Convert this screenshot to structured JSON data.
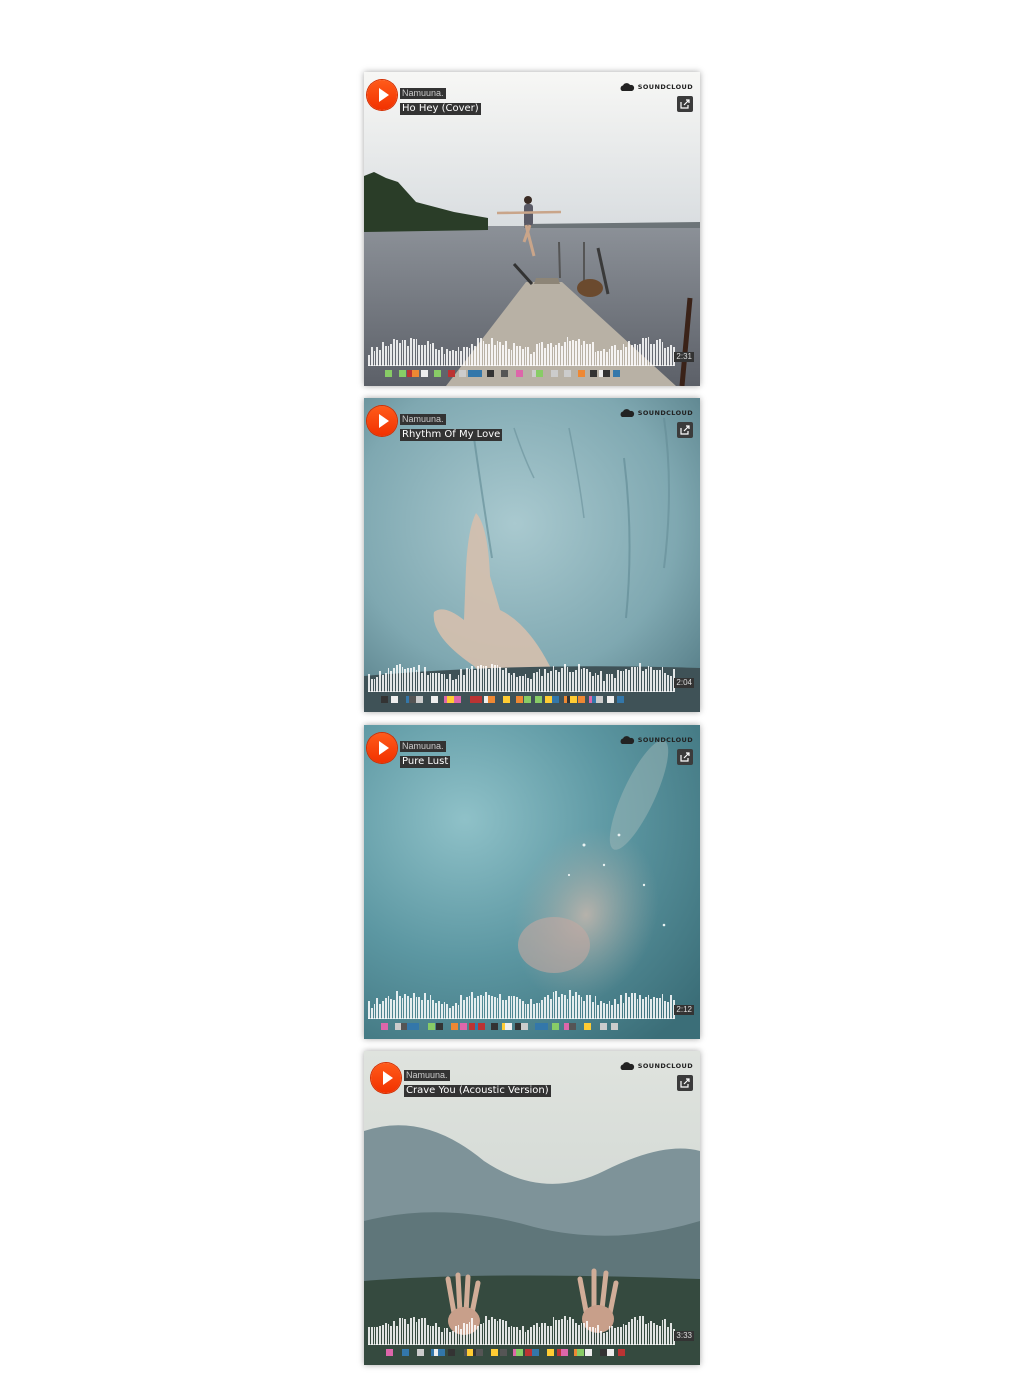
{
  "brand": {
    "accent": "#ff5500",
    "logo_text": "SOUNDCLOUD"
  },
  "players": [
    {
      "artist": "Namuuna.",
      "title": "Ho Hey (Cover)",
      "duration": "2:31",
      "artwork": "pier-jump",
      "icons": [
        "play-icon",
        "soundcloud-cloud-icon",
        "share-icon"
      ]
    },
    {
      "artist": "Namuuna.",
      "title": "Rhythm Of My Love",
      "duration": "2:04",
      "artwork": "hand-on-wet-glass",
      "icons": [
        "play-icon",
        "soundcloud-cloud-icon",
        "share-icon"
      ]
    },
    {
      "artist": "Namuuna.",
      "title": "Pure Lust",
      "duration": "2:12",
      "artwork": "underwater-dive",
      "icons": [
        "play-icon",
        "soundcloud-cloud-icon",
        "share-icon"
      ]
    },
    {
      "artist": "Namuuna.",
      "title": "Crave You (Acoustic Version)",
      "duration": "3:33",
      "artwork": "hands-in-grass",
      "icons": [
        "play-icon",
        "soundcloud-cloud-icon",
        "share-icon"
      ]
    }
  ]
}
